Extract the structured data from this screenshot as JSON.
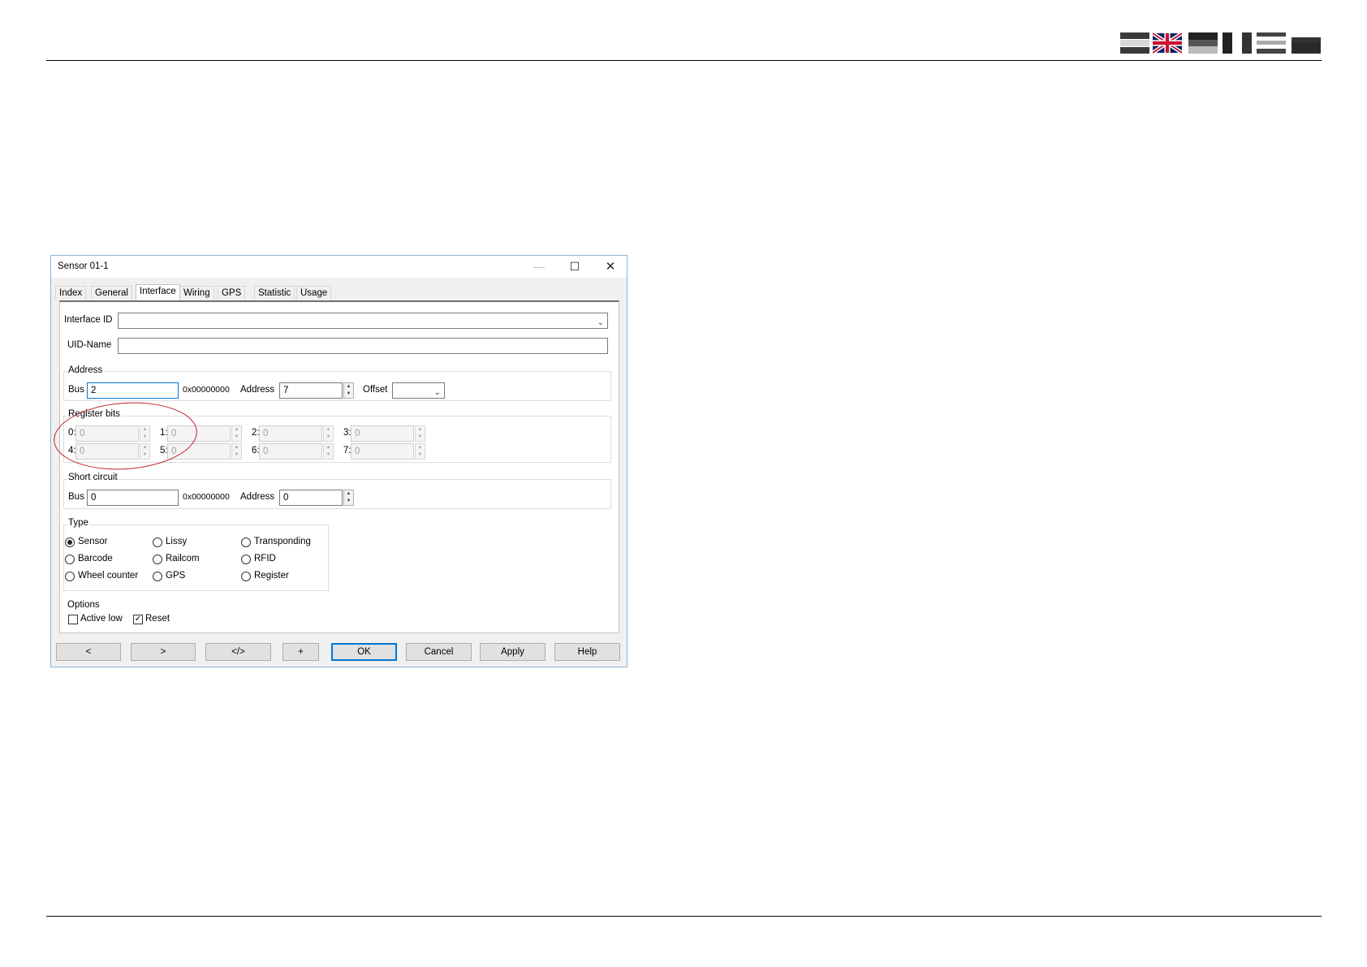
{
  "page": {
    "language_flags": [
      "flag-1",
      "uk-flag",
      "flag-3",
      "flag-4",
      "flag-5",
      "flag-6"
    ]
  },
  "dialog": {
    "title": "Sensor 01-1",
    "window_buttons": {
      "minimize": "—",
      "maximize": "☐",
      "close": "✕"
    },
    "tabs": [
      "Index",
      "General",
      "Interface",
      "Wiring",
      "GPS",
      "Statistic",
      "Usage"
    ],
    "active_tab": "Interface",
    "interface_id": {
      "label": "Interface ID",
      "value": ""
    },
    "uid_name": {
      "label": "UID-Name",
      "value": ""
    },
    "address_group": {
      "label": "Address",
      "bus_label": "Bus",
      "bus_value": "2",
      "hex": "0x00000000",
      "address_label": "Address",
      "address_value": "7",
      "offset_label": "Offset",
      "offset_value": ""
    },
    "register_bits": {
      "label": "Register bits",
      "bits": [
        {
          "label": "0:",
          "value": "0"
        },
        {
          "label": "1:",
          "value": "0"
        },
        {
          "label": "2:",
          "value": "0"
        },
        {
          "label": "3:",
          "value": "0"
        },
        {
          "label": "4:",
          "value": "0"
        },
        {
          "label": "5:",
          "value": "0"
        },
        {
          "label": "6:",
          "value": "0"
        },
        {
          "label": "7:",
          "value": "0"
        }
      ]
    },
    "short_circuit": {
      "label": "Short circuit",
      "bus_label": "Bus",
      "bus_value": "0",
      "hex": "0x00000000",
      "address_label": "Address",
      "address_value": "0"
    },
    "type": {
      "label": "Type",
      "options": [
        "Sensor",
        "Lissy",
        "Transponding",
        "Barcode",
        "Railcom",
        "RFID",
        "Wheel counter",
        "GPS",
        "Register"
      ],
      "selected": "Sensor"
    },
    "options": {
      "label": "Options",
      "active_low": {
        "label": "Active low",
        "checked": false
      },
      "reset": {
        "label": "Reset",
        "checked": true
      }
    },
    "buttons": {
      "prev": "<",
      "next": ">",
      "code": "</>",
      "add": "+",
      "ok": "OK",
      "cancel": "Cancel",
      "apply": "Apply",
      "help": "Help"
    },
    "highlight_color": "#c0202a"
  }
}
